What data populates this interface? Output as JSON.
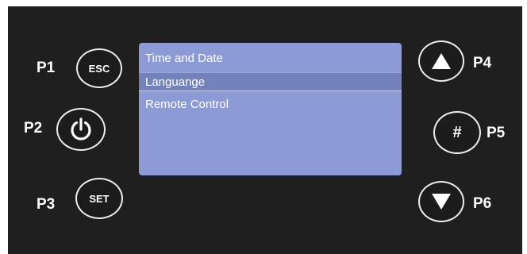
{
  "menu": {
    "items": [
      {
        "label": "Time and Date",
        "selected": false
      },
      {
        "label": "Languange",
        "selected": true
      },
      {
        "label": "Remote Control",
        "selected": false
      }
    ]
  },
  "buttons": {
    "p1": {
      "label": "P1",
      "text": "ESC"
    },
    "p2": {
      "label": "P2",
      "icon": "power-icon"
    },
    "p3": {
      "label": "P3",
      "text": "SET"
    },
    "p4": {
      "label": "P4",
      "icon": "arrow-up-icon"
    },
    "p5": {
      "label": "P5",
      "text": "#"
    },
    "p6": {
      "label": "P6",
      "icon": "arrow-down-icon"
    }
  },
  "colors": {
    "panel": "#1f1f1f",
    "screen": "#8c9bd6",
    "selection": "#7482bb",
    "text": "#ffffff"
  }
}
